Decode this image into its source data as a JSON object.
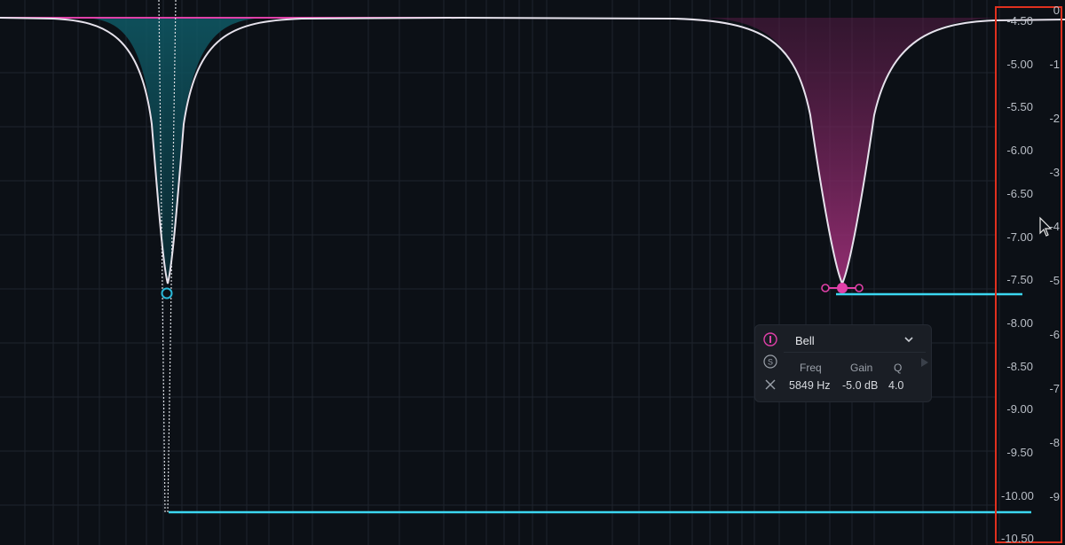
{
  "db_scale": [
    "-4.50",
    "-5.00",
    "-5.50",
    "-6.00",
    "-6.50",
    "-7.00",
    "-7.50",
    "-8.00",
    "-8.50",
    "-9.00",
    "-9.50",
    "-10.00",
    "-10.50"
  ],
  "gain_scale": [
    "0",
    "-1",
    "-2",
    "-3",
    "-4",
    "-5",
    "-6",
    "-7",
    "-8",
    "-9"
  ],
  "band_panel": {
    "type": "Bell",
    "freq_label": "Freq",
    "gain_label": "Gain",
    "q_label": "Q",
    "freq_value": "5849 Hz",
    "gain_value": "-5.0 dB",
    "q_value": "4.0",
    "icons": [
      "power-icon",
      "solo-icon",
      "close-icon",
      "chevron-down-icon",
      "play-right-icon"
    ]
  },
  "bands": [
    {
      "name": "band-1",
      "color": "#2ab8d8",
      "state": "inactive-hollow-node"
    },
    {
      "name": "band-2",
      "color": "#e040a8",
      "state": "selected-filled-node"
    }
  ],
  "colors": {
    "background": "#0c1016",
    "curve": "#e6e2ec",
    "band1": "#2ab8d8",
    "band2": "#e040a8",
    "cyan_line": "#3bd6f0",
    "highlight_box": "#e0301e"
  }
}
